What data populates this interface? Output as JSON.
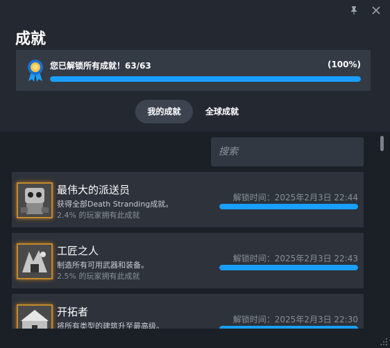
{
  "window": {
    "pin_icon": "pin-icon",
    "close_icon": "close-icon"
  },
  "header": {
    "title": "成就"
  },
  "progress": {
    "text": "您已解锁所有成就！63/63",
    "percent_text": "(100%)",
    "unlocked": 63,
    "total": 63,
    "fill_fraction": 1.0,
    "accent_color": "#1a9fff"
  },
  "tabs": [
    {
      "label": "我的成就",
      "active": true
    },
    {
      "label": "全球成就",
      "active": false
    }
  ],
  "search": {
    "placeholder": "搜索"
  },
  "achievements": [
    {
      "name": "最伟大的派送员",
      "description": "获得全部Death Stranding成就。",
      "rarity": "2.4% 的玩家拥有此成就",
      "unlock_time": "解锁时间：2025年2月3日 22:44",
      "progress_fraction": 1.0
    },
    {
      "name": "工匠之人",
      "description": "制造所有可用武器和装备。",
      "rarity": "2.5% 的玩家拥有此成就",
      "unlock_time": "解锁时间：2025年2月3日 22:43",
      "progress_fraction": 1.0
    },
    {
      "name": "开拓者",
      "description": "将所有类型的建筑升至最高级。",
      "rarity": "",
      "unlock_time": "解锁时间：2025年2月3日 22:30",
      "progress_fraction": 1.0
    }
  ]
}
